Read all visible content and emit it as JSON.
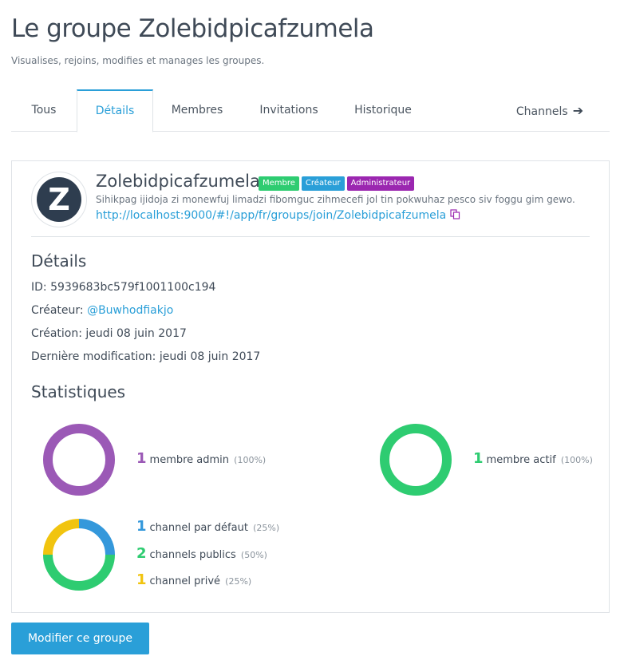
{
  "header": {
    "title": "Le groupe Zolebidpicafzumela",
    "subtitle": "Visualises, rejoins, modifies et manages les groupes."
  },
  "tabs": [
    {
      "label": "Tous",
      "active": false
    },
    {
      "label": "Détails",
      "active": true
    },
    {
      "label": "Membres",
      "active": false
    },
    {
      "label": "Invitations",
      "active": false
    },
    {
      "label": "Historique",
      "active": false
    },
    {
      "label": "Channels",
      "active": false,
      "icon": "arrow-right-icon"
    }
  ],
  "group": {
    "avatar_letter": "Z",
    "name": "Zolebidpicafzumela",
    "badges": {
      "member": "Membre",
      "creator": "Créateur",
      "admin": "Administrateur"
    },
    "description": "Sihikpag ijidoja zi monewfuj limadzi fibomguc zihmecefi jol tin pokwuhaz pesco siv foggu gim gewo.",
    "invite_link": "http://localhost:9000/#!/app/fr/groups/join/Zolebidpicafzumela"
  },
  "details": {
    "title": "Détails",
    "id_label": "ID:",
    "id_value": "5939683bc579f1001100c194",
    "creator_label": "Créateur:",
    "creator_value": "@Buwhodfiakjo",
    "created_label": "Création:",
    "created_value": "jeudi 08 juin 2017",
    "modified_label": "Dernière modification:",
    "modified_value": "jeudi 08 juin 2017"
  },
  "stats": {
    "title": "Statistiques",
    "admins": {
      "count": "1",
      "label": "membre admin",
      "pct": "(100%)"
    },
    "active": {
      "count": "1",
      "label": "membre actif",
      "pct": "(100%)"
    },
    "default_channels": {
      "count": "1",
      "label": "channel par défaut",
      "pct": "(25%)"
    },
    "public_channels": {
      "count": "2",
      "label": "channels publics",
      "pct": "(50%)"
    },
    "private_channels": {
      "count": "1",
      "label": "channel privé",
      "pct": "(25%)"
    }
  },
  "colors": {
    "accent": "#2a9fd8",
    "admin": "#9b59b6",
    "active": "#2ecc71",
    "default": "#3498db",
    "public": "#2ecc71",
    "private": "#f1c40f"
  },
  "actions": {
    "edit_label": "Modifier ce groupe"
  }
}
